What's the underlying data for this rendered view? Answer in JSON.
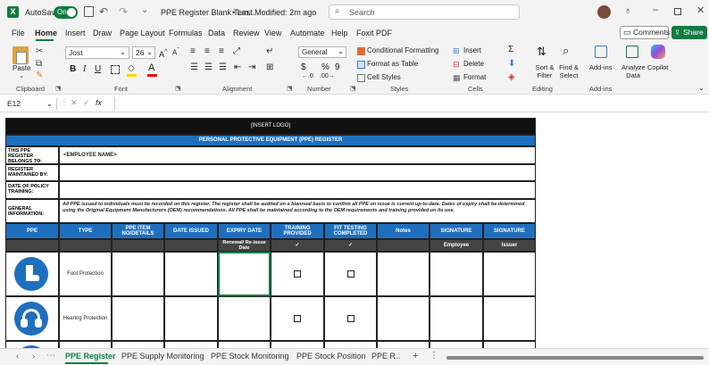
{
  "title_bar": {
    "autosave_label": "AutoSave",
    "autosave_state": "On",
    "file_name": "PPE Register Blank Tem...",
    "last_modified": "• Last Modified: 2m ago",
    "search_placeholder": "Search"
  },
  "menu": {
    "items": [
      "File",
      "Home",
      "Insert",
      "Draw",
      "Page Layout",
      "Formulas",
      "Data",
      "Review",
      "View",
      "Automate",
      "Help",
      "Foxit PDF"
    ],
    "comments": "Comments",
    "share": "Share"
  },
  "ribbon": {
    "paste": "Paste",
    "clipboard": "Clipboard",
    "font_name": "Jost",
    "font_size": "26",
    "font_group": "Font",
    "alignment_group": "Alignment",
    "number_format": "General",
    "number_group": "Number",
    "cond_format": "Conditional Formatting",
    "format_table": "Format as Table",
    "cell_styles": "Cell Styles",
    "styles_group": "Styles",
    "insert": "Insert",
    "delete": "Delete",
    "format": "Format",
    "cells_group": "Cells",
    "sort_filter": "Sort & Filter",
    "find_select": "Find & Select",
    "editing_group": "Editing",
    "add_ins": "Add-ins",
    "addins_group": "Add-ins",
    "analyze": "Analyze Data",
    "copilot": "Copilot"
  },
  "formula_bar": {
    "name_box": "E12",
    "fx": "fx",
    "value": ""
  },
  "sheet": {
    "logo": "[INSERT LOGO]",
    "title": "PERSONAL PROTECTIVE EQUIPMENT (PPE) REGISTER",
    "belongs_label": "THIS PPE REGISTER BELONGS TO:",
    "belongs_value": "<EMPLOYEE NAME>",
    "maintained_label": "REGISTER MAINTAINED BY:",
    "policy_label": "DATE OF POLICY TRAINING:",
    "general_label": "GENERAL INFORMATION:",
    "general_text": "All PPE issued to individuals must be recorded on this register. The register shall be audited on a biannual basis to confirm all PPE on issue is current up-to-date. Dates of expiry shall be determined using the Original Equipment Manufacturers (OEM) recommendations. All PPE shall be maintained according to the OEM requirements and training provided on its use.",
    "columns": [
      "PPE",
      "TYPE",
      "PPE ITEM NO/DETAILS",
      "DATE ISSUED",
      "EXPIRY DATE",
      "TRAINING PROVIDED",
      "FIT TESTING COMPLETED",
      "Notes",
      "SIGNATURE",
      "SIGNATURE"
    ],
    "subheaders": [
      "",
      "",
      "",
      "",
      "Renewal/ Re-issue Date",
      "✓",
      "✓",
      "",
      "Employee",
      "Issuer"
    ],
    "rows": [
      {
        "type": "Foot Protection"
      },
      {
        "type": "Hearing Protection"
      }
    ]
  },
  "tabs": {
    "items": [
      "PPE Register",
      "PPE Supply Monitoring",
      "PPE Stock Monitoring",
      "PPE Stock Position",
      "PPE R"
    ],
    "more": "..."
  },
  "colors": {
    "accent": "#1f6fbf",
    "excel_green": "#107c41"
  }
}
